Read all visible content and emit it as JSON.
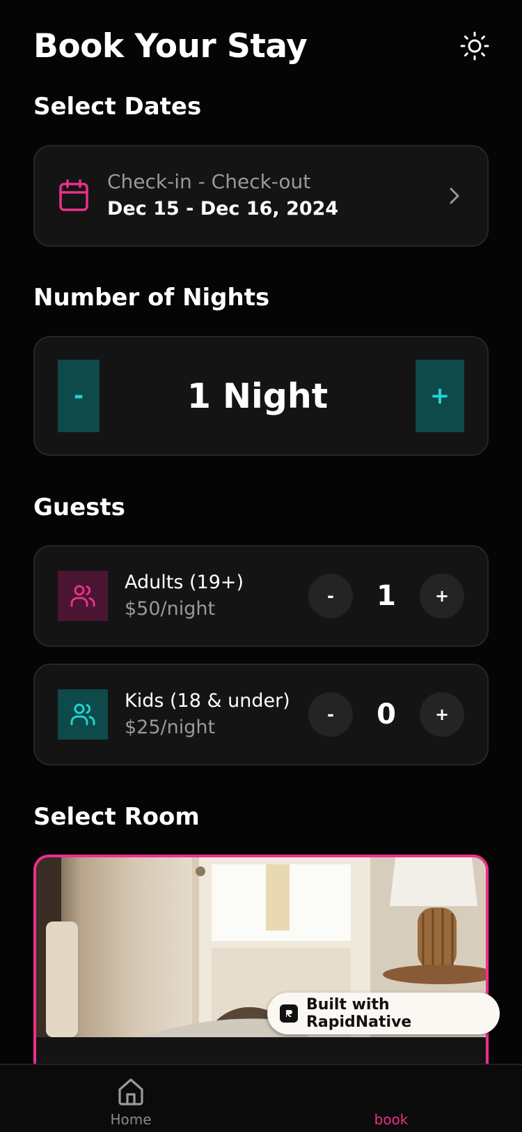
{
  "header": {
    "title": "Book Your Stay",
    "theme_icon": "sun-icon"
  },
  "dates": {
    "section_title": "Select Dates",
    "label": "Check-in - Check-out",
    "value": "Dec 15 - Dec 16, 2024"
  },
  "nights": {
    "section_title": "Number of Nights",
    "decrement_label": "-",
    "increment_label": "+",
    "value": "1 Night"
  },
  "guests": {
    "section_title": "Guests",
    "items": [
      {
        "name": "Adults (19+)",
        "price": "$50/night",
        "count": "1",
        "minus": "-",
        "plus": "+",
        "accent": "#ec2f8c"
      },
      {
        "name": "Kids (18 & under)",
        "price": "$25/night",
        "count": "0",
        "minus": "-",
        "plus": "+",
        "accent": "#22d3d3"
      }
    ]
  },
  "room": {
    "section_title": "Select Room"
  },
  "badge": {
    "text": "Built with RapidNative"
  },
  "tabs": [
    {
      "label": "Home",
      "icon": "home-icon"
    },
    {
      "label": "book"
    }
  ],
  "colors": {
    "accent_pink": "#ec2f8c",
    "accent_teal": "#22d3d3",
    "background": "#050505",
    "card": "#141414"
  }
}
